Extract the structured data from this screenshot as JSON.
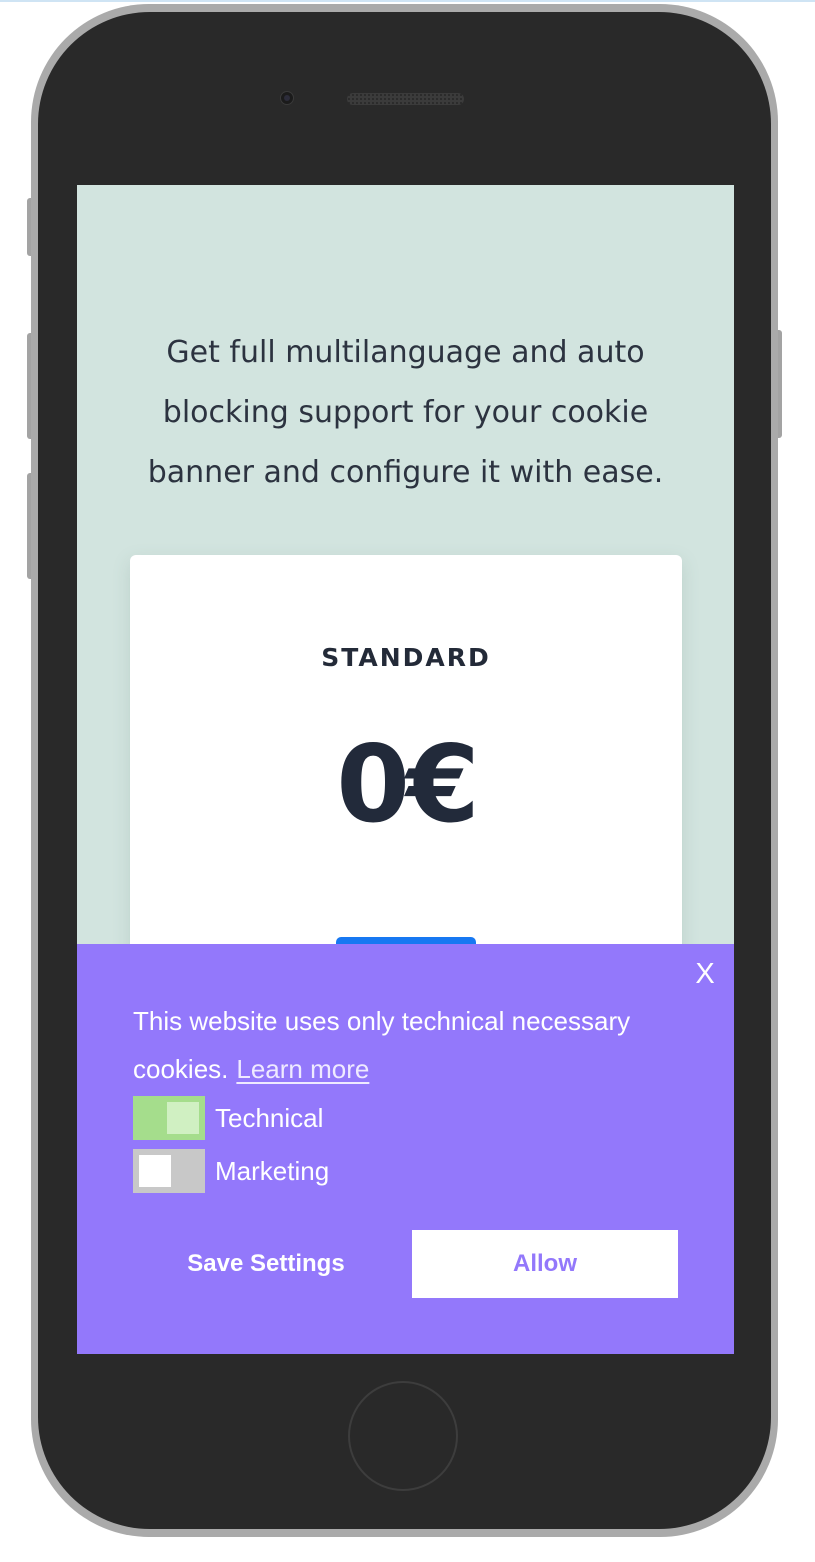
{
  "hero": {
    "text": "Get full multilanguage and auto blocking support for your cookie banner and configure it with ease."
  },
  "pricing_card": {
    "plan_name": "STANDARD",
    "price": "0€"
  },
  "cookie_banner": {
    "close_label": "X",
    "message": "This website uses only technical necessary cookies.",
    "learn_more": "Learn more",
    "toggles": [
      {
        "label": "Technical",
        "enabled": true
      },
      {
        "label": "Marketing",
        "enabled": false
      }
    ],
    "save_label": "Save Settings",
    "allow_label": "Allow"
  },
  "colors": {
    "banner_bg": "#9378fb",
    "screen_bg": "#d2e4df",
    "cta_blue": "#1778f2",
    "toggle_on": "#a5dd8c",
    "toggle_off": "#c8c8c8"
  }
}
